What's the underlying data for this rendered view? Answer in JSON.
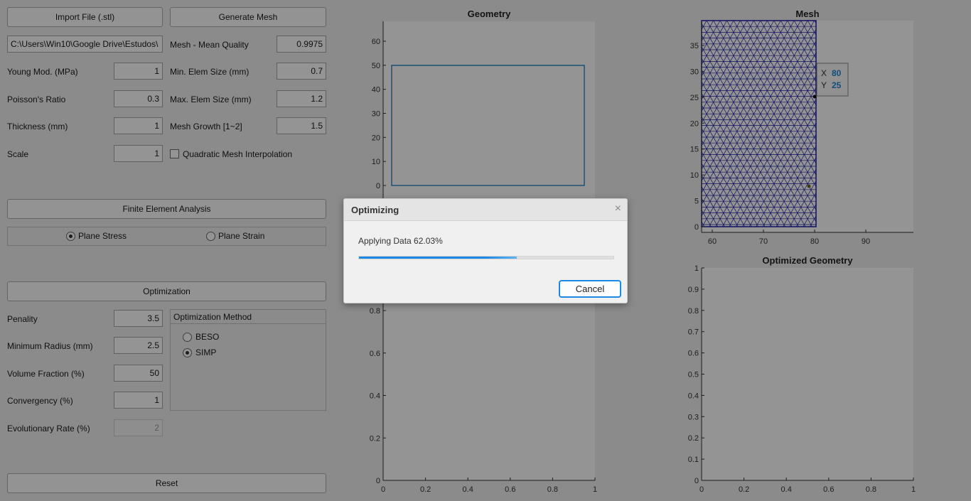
{
  "buttons": {
    "import": "Import File (.stl)",
    "generate_mesh": "Generate Mesh",
    "fea": "Finite Element Analysis",
    "optimization": "Optimization",
    "reset": "Reset"
  },
  "file_path": "C:\\Users\\Win10\\Google Drive\\Estudos\\",
  "material": {
    "young_label": "Young Mod. (MPa)",
    "young_value": "1",
    "poisson_label": "Poisson's Ratio",
    "poisson_value": "0.3",
    "thickness_label": "Thickness (mm)",
    "thickness_value": "1",
    "scale_label": "Scale",
    "scale_value": "1"
  },
  "mesh": {
    "quality_label": "Mesh - Mean Quality",
    "quality_value": "0.9975",
    "min_label": "Min. Elem Size (mm)",
    "min_value": "0.7",
    "max_label": "Max. Elem Size (mm)",
    "max_value": "1.2",
    "growth_label": "Mesh Growth [1~2]",
    "growth_value": "1.5",
    "quadratic_label": "Quadratic Mesh Interpolation"
  },
  "analysis": {
    "plane_stress": "Plane Stress",
    "plane_strain": "Plane Strain"
  },
  "opt": {
    "penalty_label": "Penality",
    "penalty_value": "3.5",
    "radius_label": "Minimum Radius (mm)",
    "radius_value": "2.5",
    "volume_label": "Volume Fraction (%)",
    "volume_value": "50",
    "conv_label": "Convergency (%)",
    "conv_value": "1",
    "evo_label": "Evolutionary Rate (%)",
    "evo_value": "2",
    "method_title": "Optimization Method",
    "beso": "BESO",
    "simp": "SIMP"
  },
  "plots": {
    "geometry_title": "Geometry",
    "mesh_title": "Mesh",
    "optimized_title": "Optimized Geometry",
    "geometry_yticks": [
      "60",
      "50",
      "40",
      "30",
      "20",
      "10",
      "0"
    ],
    "mesh_yticks": [
      "35",
      "30",
      "25",
      "20",
      "15",
      "10",
      "5",
      "0"
    ],
    "mesh_xticks": [
      "60",
      "70",
      "80",
      "90"
    ],
    "unit_yticks": [
      "1",
      "0.9",
      "0.8",
      "0.7",
      "0.6",
      "0.5",
      "0.4",
      "0.3",
      "0.2",
      "0.1",
      "0"
    ],
    "unit_xticks": [
      "0",
      "0.2",
      "0.4",
      "0.6",
      "0.8",
      "1"
    ],
    "left_lower_yticks": [
      "0.8",
      "0.6",
      "0.4",
      "0.2",
      "0"
    ],
    "datatip_x_label": "X",
    "datatip_x_value": "80",
    "datatip_y_label": "Y",
    "datatip_y_value": "25",
    "mesh_color": "#1c1ca8",
    "geometry_color": "#0072bd"
  },
  "dialog": {
    "title": "Optimizing",
    "message": "Applying Data 62.03%",
    "progress": 0.6203,
    "cancel": "Cancel",
    "close_icon": "×"
  }
}
